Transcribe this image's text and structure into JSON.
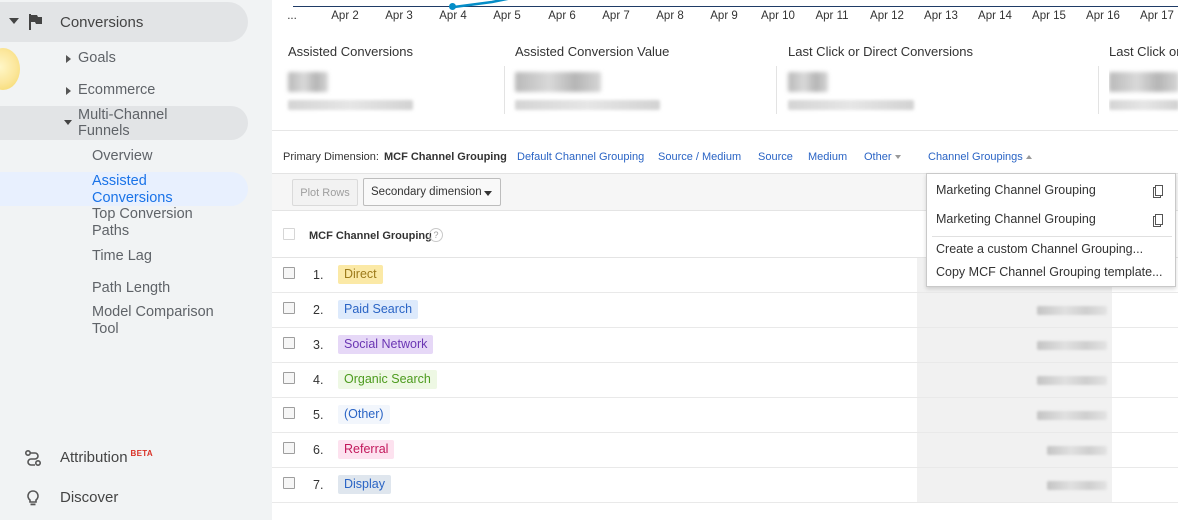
{
  "sidebar": {
    "conversions": "Conversions",
    "goals": "Goals",
    "ecommerce": "Ecommerce",
    "mcf": "Multi-Channel Funnels",
    "overview": "Overview",
    "assisted": "Assisted Conversions",
    "top_paths": "Top Conversion Paths",
    "time_lag": "Time Lag",
    "path_length": "Path Length",
    "model_tool": "Model Comparison Tool",
    "attribution": "Attribution",
    "beta": "BETA",
    "discover": "Discover"
  },
  "chart": {
    "x_ticks": [
      "...",
      "Apr 2",
      "Apr 3",
      "Apr 4",
      "Apr 5",
      "Apr 6",
      "Apr 7",
      "Apr 8",
      "Apr 9",
      "Apr 10",
      "Apr 11",
      "Apr 12",
      "Apr 13",
      "Apr 14",
      "Apr 15",
      "Apr 16",
      "Apr 17"
    ],
    "line_color": "#058dc7"
  },
  "scorecards": [
    {
      "name": "Assisted Conversions"
    },
    {
      "name": "Assisted Conversion Value"
    },
    {
      "name": "Last Click or Direct Conversions"
    },
    {
      "name": "Last Click or"
    }
  ],
  "dimensions": {
    "label": "Primary Dimension:",
    "current": "MCF Channel Grouping",
    "links": [
      "Default Channel Grouping",
      "Source / Medium",
      "Source",
      "Medium"
    ],
    "other": "Other",
    "channel_groupings": "Channel Groupings"
  },
  "toolbar": {
    "plot_rows": "Plot Rows",
    "secondary_dimension": "Secondary dimension"
  },
  "table": {
    "header": "MCF Channel Grouping",
    "help": "?",
    "rows": [
      {
        "index": "1.",
        "label": "Direct",
        "bg": "#fbe9a6",
        "fg": "#9c7a1a"
      },
      {
        "index": "2.",
        "label": "Paid Search",
        "bg": "#ddeafc",
        "fg": "#2a64c5"
      },
      {
        "index": "3.",
        "label": "Social Network",
        "bg": "#e6d8f7",
        "fg": "#6a35b3"
      },
      {
        "index": "4.",
        "label": "Organic Search",
        "bg": "#eef8e4",
        "fg": "#4c9b1d"
      },
      {
        "index": "5.",
        "label": "(Other)",
        "bg": "#f2f6fc",
        "fg": "#2a64c5"
      },
      {
        "index": "6.",
        "label": "Referral",
        "bg": "#fde2ef",
        "fg": "#c2185b"
      },
      {
        "index": "7.",
        "label": "Display",
        "bg": "#dfe6ee",
        "fg": "#2a64c5"
      }
    ]
  },
  "dropdown": {
    "items": [
      "Marketing Channel Grouping",
      "Marketing Channel Grouping"
    ],
    "create": "Create a custom Channel Grouping...",
    "copy": "Copy MCF Channel Grouping template..."
  }
}
